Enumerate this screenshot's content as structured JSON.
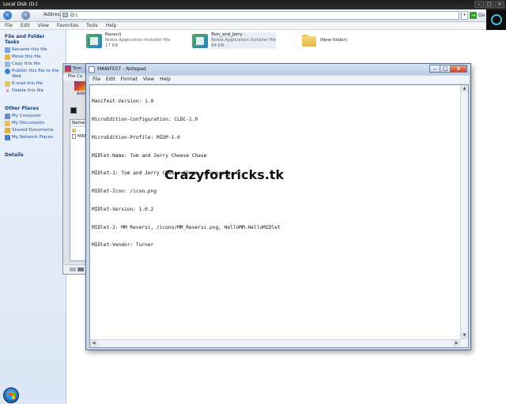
{
  "explorer": {
    "title": "Local Disk (D:)",
    "address_label": "Address",
    "address_value": "D:\\",
    "go_label": "Go",
    "menu": [
      "File",
      "Edit",
      "View",
      "Favorites",
      "Tools",
      "Help"
    ]
  },
  "taskpane": {
    "file_tasks_header": "File and Folder Tasks",
    "file_tasks": [
      {
        "label": "Rename this file",
        "icon": "rename-icon"
      },
      {
        "label": "Move this file",
        "icon": "move-icon"
      },
      {
        "label": "Copy this file",
        "icon": "copy-icon"
      },
      {
        "label": "Publish this file to the Web",
        "icon": "globe-icon"
      },
      {
        "label": "E-mail this file",
        "icon": "email-icon"
      },
      {
        "label": "Delete this file",
        "icon": "delete-icon"
      }
    ],
    "other_places_header": "Other Places",
    "other_places": [
      {
        "label": "My Computer",
        "icon": "computer-icon"
      },
      {
        "label": "My Documents",
        "icon": "documents-icon"
      },
      {
        "label": "Shared Documents",
        "icon": "shared-documents-icon"
      },
      {
        "label": "My Network Places",
        "icon": "network-icon"
      }
    ],
    "details_header": "Details"
  },
  "files": [
    {
      "name": "Raven1",
      "type": "Nokia Application Installer file",
      "size": "17 KB"
    },
    {
      "name": "Tom_and_Jerry",
      "type": "Nokia Application Installer file",
      "size": "84 KB"
    },
    {
      "name": "(New folder)"
    }
  ],
  "archive_window": {
    "title": "Tom",
    "menu": "File Co",
    "tool_label": "Add",
    "column_name": "Name",
    "rows": [
      "..",
      "MANI"
    ]
  },
  "notepad": {
    "title": "MANIFEST - Notepad",
    "menu": [
      "File",
      "Edit",
      "Format",
      "View",
      "Help"
    ],
    "lines": [
      "Manifest-Version: 1.0",
      "MicroEdition-Configuration: CLDC-1.0",
      "MicroEdition-Profile: MIDP-1.0",
      "MIDlet-Name: Tom and Jerry Cheese Chase",
      "MIDlet-1: Tom and Jerry Cheese Chase, /icon.png, b",
      "MIDlet-Icon: /icon.png",
      "MIDlet-Version: 1.0.2",
      "MIDlet-2: MM Reversi, /icons/MM_Reversi.png, HelloMM.HelloMIDlet",
      "MIDlet-Vendor: Turner"
    ],
    "watermark": "Crazyfortricks.tk"
  }
}
